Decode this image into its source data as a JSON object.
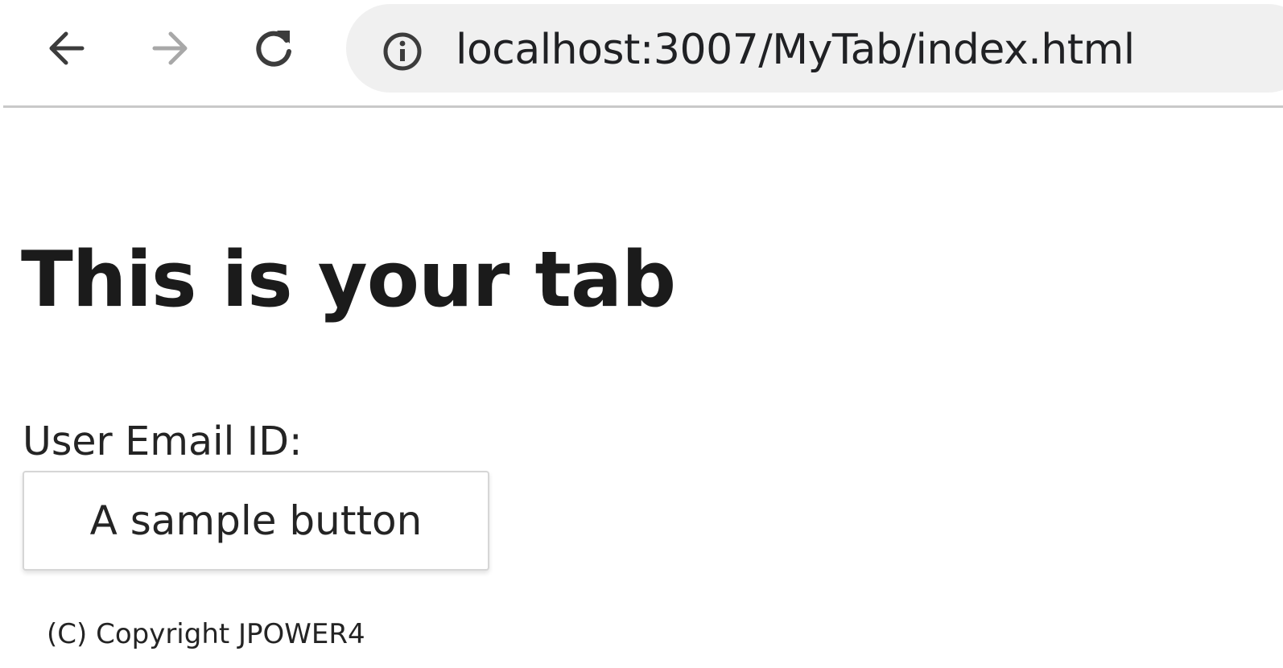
{
  "browser": {
    "url": "localhost:3007/MyTab/index.html",
    "icons": {
      "back": "back-arrow-icon",
      "forward": "forward-arrow-icon",
      "reload": "reload-icon",
      "site_info": "info-icon"
    },
    "colors": {
      "toolbar_bg": "#ffffff",
      "omnibox_bg": "#f0f0f0",
      "icon_active": "#3c3c3c",
      "icon_disabled": "#a8a8a8"
    }
  },
  "page": {
    "title": "This is your tab",
    "email_label": "User Email ID:",
    "sample_button_label": "A sample button",
    "copyright": "(C) Copyright JPOWER4"
  }
}
